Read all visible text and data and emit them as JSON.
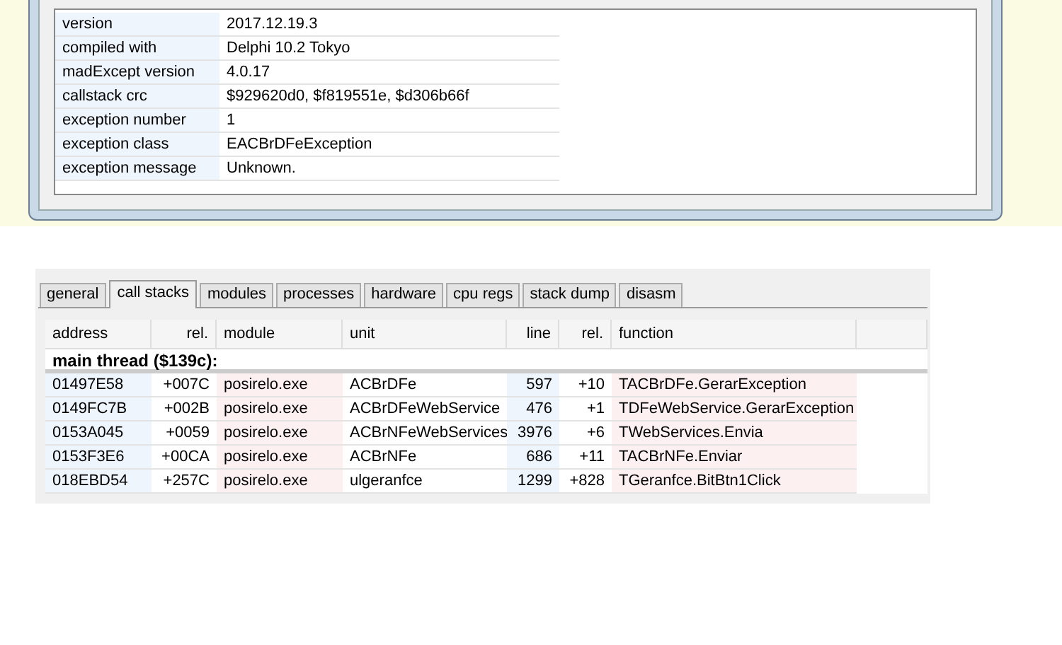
{
  "info_table": {
    "rows": [
      {
        "key": "version",
        "value": "2017.12.19.3"
      },
      {
        "key": "compiled with",
        "value": "Delphi 10.2 Tokyo"
      },
      {
        "key": "madExcept version",
        "value": "4.0.17"
      },
      {
        "key": "callstack crc",
        "value": "$929620d0, $f819551e, $d306b66f"
      },
      {
        "key": "exception number",
        "value": "1"
      },
      {
        "key": "exception class",
        "value": "EACBrDFeException"
      },
      {
        "key": "exception message",
        "value": "Unknown."
      }
    ]
  },
  "tabs": [
    {
      "label": "general",
      "selected": false
    },
    {
      "label": "call stacks",
      "selected": true
    },
    {
      "label": "modules",
      "selected": false
    },
    {
      "label": "processes",
      "selected": false
    },
    {
      "label": "hardware",
      "selected": false
    },
    {
      "label": "cpu regs",
      "selected": false
    },
    {
      "label": "stack dump",
      "selected": false
    },
    {
      "label": "disasm",
      "selected": false
    }
  ],
  "table": {
    "columns": [
      "address",
      "rel.",
      "module",
      "unit",
      "line",
      "rel.",
      "function"
    ],
    "group": "main thread ($139c):",
    "rows": [
      [
        "01497E58",
        "+007C",
        "posirelo.exe",
        "ACBrDFe",
        "597",
        "+10",
        "TACBrDFe.GerarException"
      ],
      [
        "0149FC7B",
        "+002B",
        "posirelo.exe",
        "ACBrDFeWebService",
        "476",
        "+1",
        "TDFeWebService.GerarException"
      ],
      [
        "0153A045",
        "+0059",
        "posirelo.exe",
        "ACBrNFeWebServices",
        "3976",
        "+6",
        "TWebServices.Envia"
      ],
      [
        "0153F3E6",
        "+00CA",
        "posirelo.exe",
        "ACBrNFe",
        "686",
        "+11",
        "TACBrNFe.Enviar"
      ],
      [
        "018EBD54",
        "+257C",
        "posirelo.exe",
        "ulgeranfce",
        "1299",
        "+828",
        "TGeranfce.BitBtn1Click"
      ]
    ]
  }
}
